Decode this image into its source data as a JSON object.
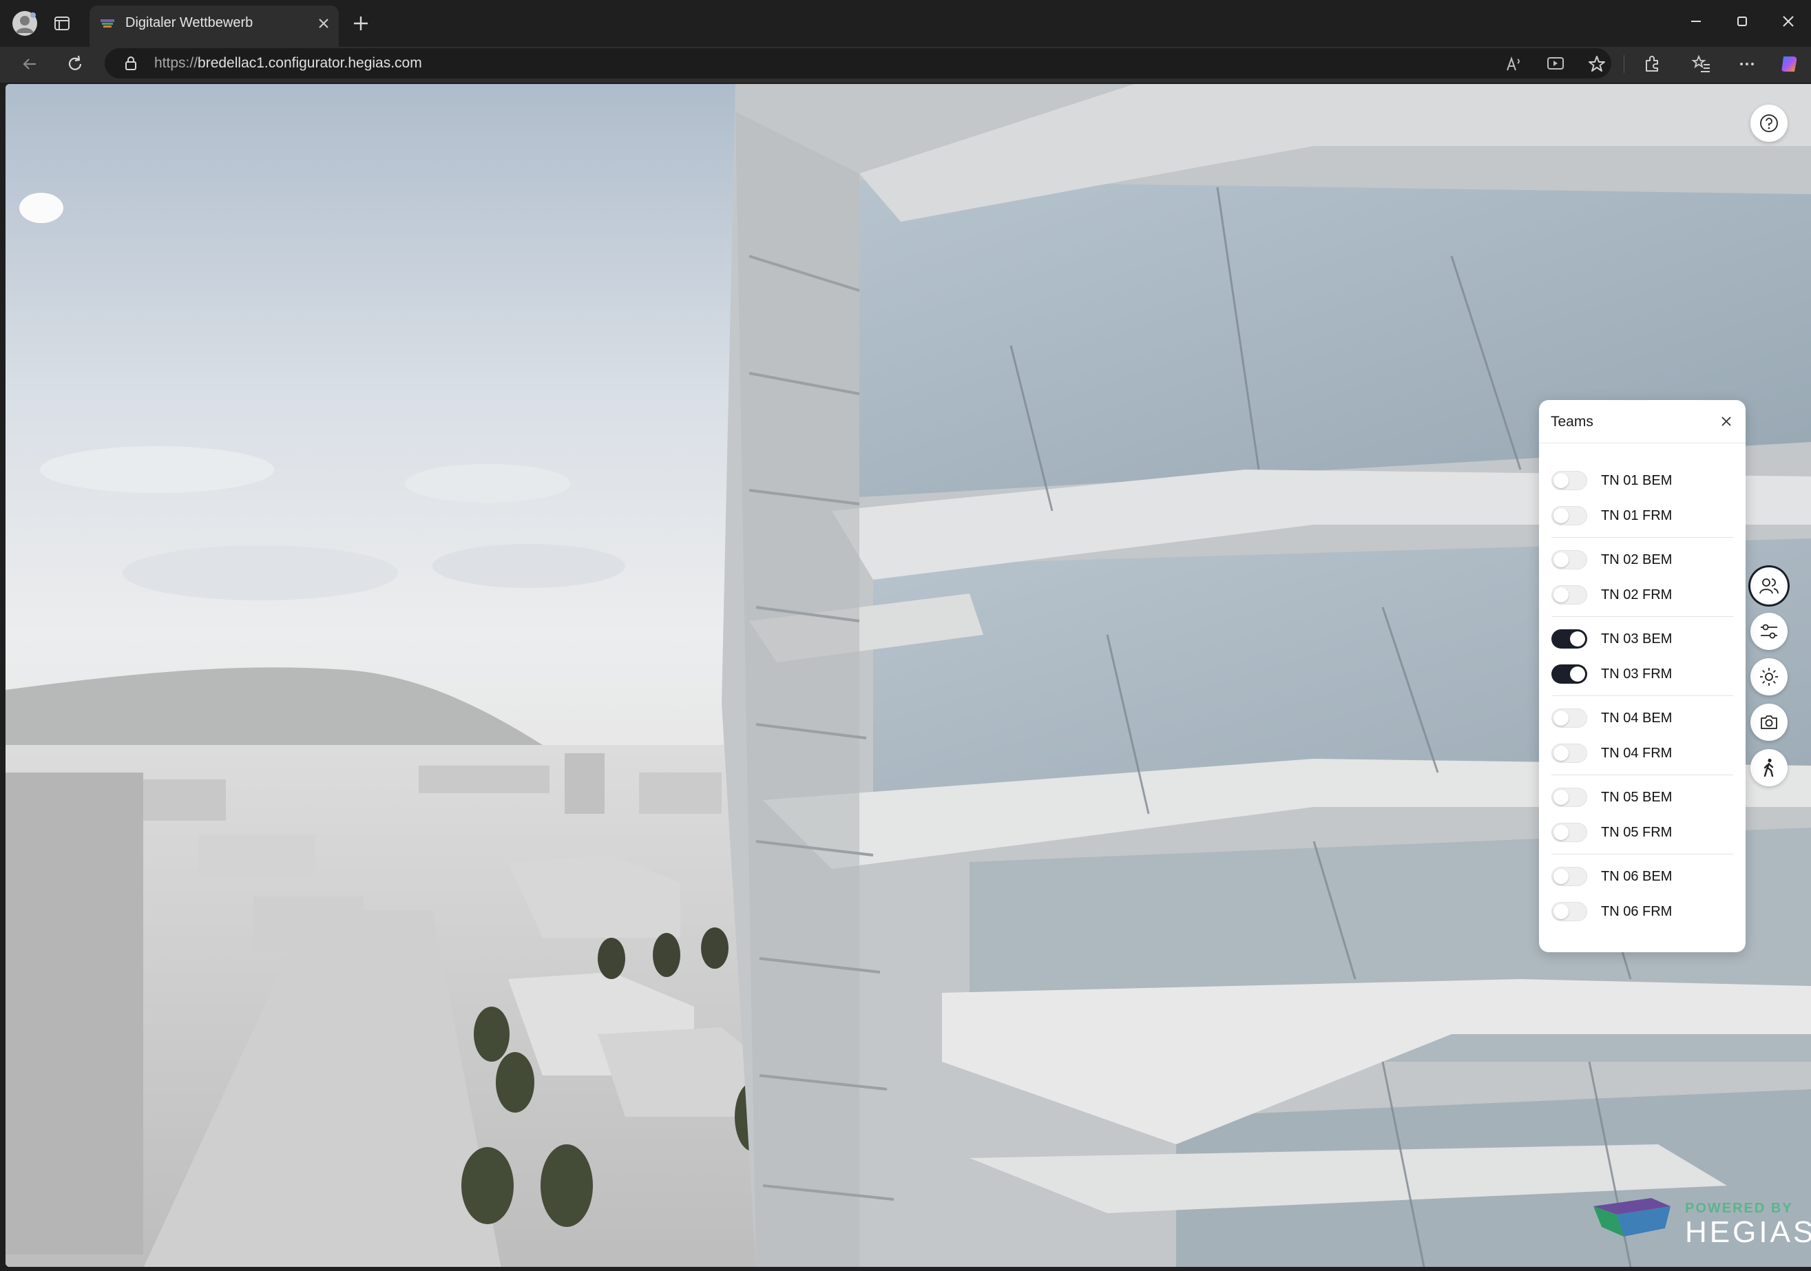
{
  "browser": {
    "tab_title": "Digitaler Wettbewerb",
    "url_scheme": "https://",
    "url_host": "bredellac1.configurator.hegias.com",
    "icons": [
      "profile-avatar-icon",
      "tab-actions-icon",
      "favicon-icon",
      "close-tab-icon",
      "new-tab-icon",
      "minimize-icon",
      "maximize-icon",
      "close-window-icon",
      "back-icon",
      "refresh-icon",
      "site-info-icon",
      "read-aloud-icon",
      "immersive-reader-icon",
      "favorite-star-icon",
      "extensions-icon",
      "favorites-icon",
      "more-icon",
      "copilot-icon"
    ]
  },
  "teams_panel": {
    "title": "Teams",
    "items": [
      {
        "label": "TN 01 BEM",
        "enabled": false
      },
      {
        "label": "TN 01 FRM",
        "enabled": false
      },
      {
        "label": "TN 02 BEM",
        "enabled": false
      },
      {
        "label": "TN 02 FRM",
        "enabled": false
      },
      {
        "label": "TN 03 BEM",
        "enabled": true
      },
      {
        "label": "TN 03 FRM",
        "enabled": true
      },
      {
        "label": "TN 04 BEM",
        "enabled": false
      },
      {
        "label": "TN 04 FRM",
        "enabled": false
      },
      {
        "label": "TN 05 BEM",
        "enabled": false
      },
      {
        "label": "TN 05 FRM",
        "enabled": false
      },
      {
        "label": "TN 06 BEM",
        "enabled": false
      },
      {
        "label": "TN 06 FRM",
        "enabled": false
      }
    ]
  },
  "toolbar": {
    "icons": [
      "help-icon",
      "teams-icon",
      "settings-sliders-icon",
      "sun-icon",
      "camera-icon",
      "walk-icon"
    ]
  },
  "watermark": {
    "powered_by": "POWERED BY",
    "brand": "HEGIAS"
  }
}
